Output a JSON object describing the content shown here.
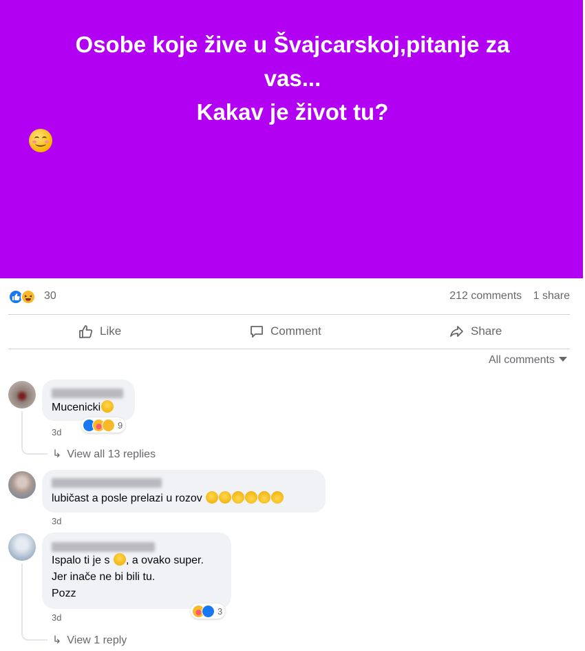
{
  "post": {
    "title_lines": [
      "Osobe koje žive u Švajcarskoj,pitanje za",
      "vas...",
      "Kakav je život tu?"
    ],
    "background_color": "#b100f2"
  },
  "stats": {
    "reaction_icons": [
      "like-icon",
      "haha-icon"
    ],
    "reaction_count": "30",
    "comments": "212 comments",
    "shares": "1 share"
  },
  "actions": {
    "like": "Like",
    "comment": "Comment",
    "share": "Share"
  },
  "filter": {
    "label": "All comments"
  },
  "comments": [
    {
      "text": "Mucenicki",
      "time": "3d",
      "reactions": {
        "icons": [
          "like-icon",
          "care-icon",
          "haha-icon"
        ],
        "count": "9"
      },
      "replies_link": "View all 13 replies"
    },
    {
      "text": "lubičast a posle prelazi u rozov",
      "time": "3d"
    },
    {
      "text_lines": [
        "Ispalo ti je s",
        ", a ovako super.",
        "Jer inače ne bi bili tu.",
        "Pozz"
      ],
      "time": "3d",
      "reactions": {
        "icons": [
          "care-icon",
          "like-icon"
        ],
        "count": "3"
      },
      "replies_link": "View 1 reply"
    }
  ]
}
